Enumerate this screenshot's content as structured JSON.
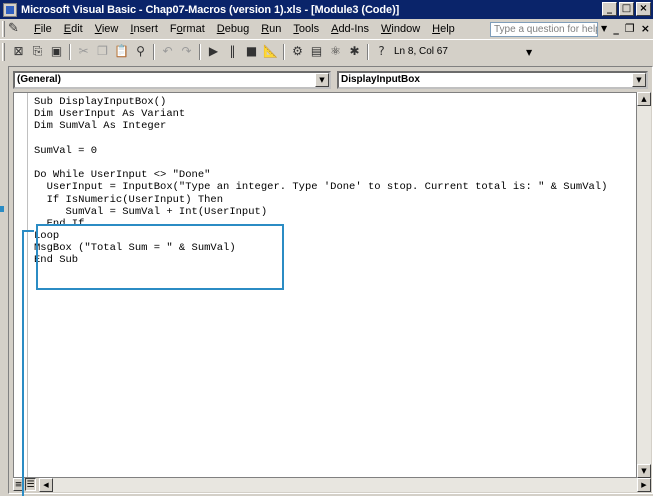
{
  "window": {
    "title": "Microsoft Visual Basic - Chap07-Macros (version 1).xls - [Module3 (Code)]",
    "controls": {
      "minimize": "_",
      "restore": "□",
      "close": "×"
    }
  },
  "menubar": {
    "items": [
      {
        "label": "File",
        "key": "F"
      },
      {
        "label": "Edit",
        "key": "E"
      },
      {
        "label": "View",
        "key": "V"
      },
      {
        "label": "Insert",
        "key": "I"
      },
      {
        "label": "Format",
        "key": "o"
      },
      {
        "label": "Debug",
        "key": "D"
      },
      {
        "label": "Run",
        "key": "R"
      },
      {
        "label": "Tools",
        "key": "T"
      },
      {
        "label": "Add-Ins",
        "key": "A"
      },
      {
        "label": "Window",
        "key": "W"
      },
      {
        "label": "Help",
        "key": "H"
      }
    ],
    "ask_placeholder": "Type a question for help",
    "child_controls": {
      "minimize": "_",
      "restore": "❐",
      "close": "×"
    }
  },
  "toolbar": {
    "position": "Ln 8, Col 67",
    "icons": [
      "view-excel-icon",
      "insert-module-icon",
      "save-icon",
      "cut-icon",
      "copy-icon",
      "paste-icon",
      "find-icon",
      "undo-icon",
      "redo-icon",
      "run-icon",
      "break-icon",
      "reset-icon",
      "design-mode-icon",
      "project-explorer-icon",
      "properties-icon",
      "object-browser-icon",
      "toolbox-icon",
      "help-icon"
    ]
  },
  "codewindow": {
    "object_combo": "(General)",
    "procedure_combo": "DisplayInputBox",
    "lines": [
      "Sub DisplayInputBox()",
      "Dim UserInput As Variant",
      "Dim SumVal As Integer",
      "",
      "SumVal = 0",
      "",
      "Do While UserInput <> \"Done\"",
      "  UserInput = InputBox(\"Type an integer. Type 'Done' to stop. Current total is: \" & SumVal)",
      "  If IsNumeric(UserInput) Then",
      "     SumVal = SumVal + Int(UserInput)",
      "  End If",
      "Loop",
      "MsgBox (\"Total Sum = \" & SumVal)",
      "End Sub"
    ],
    "highlight_color": "#2b8cc4"
  }
}
